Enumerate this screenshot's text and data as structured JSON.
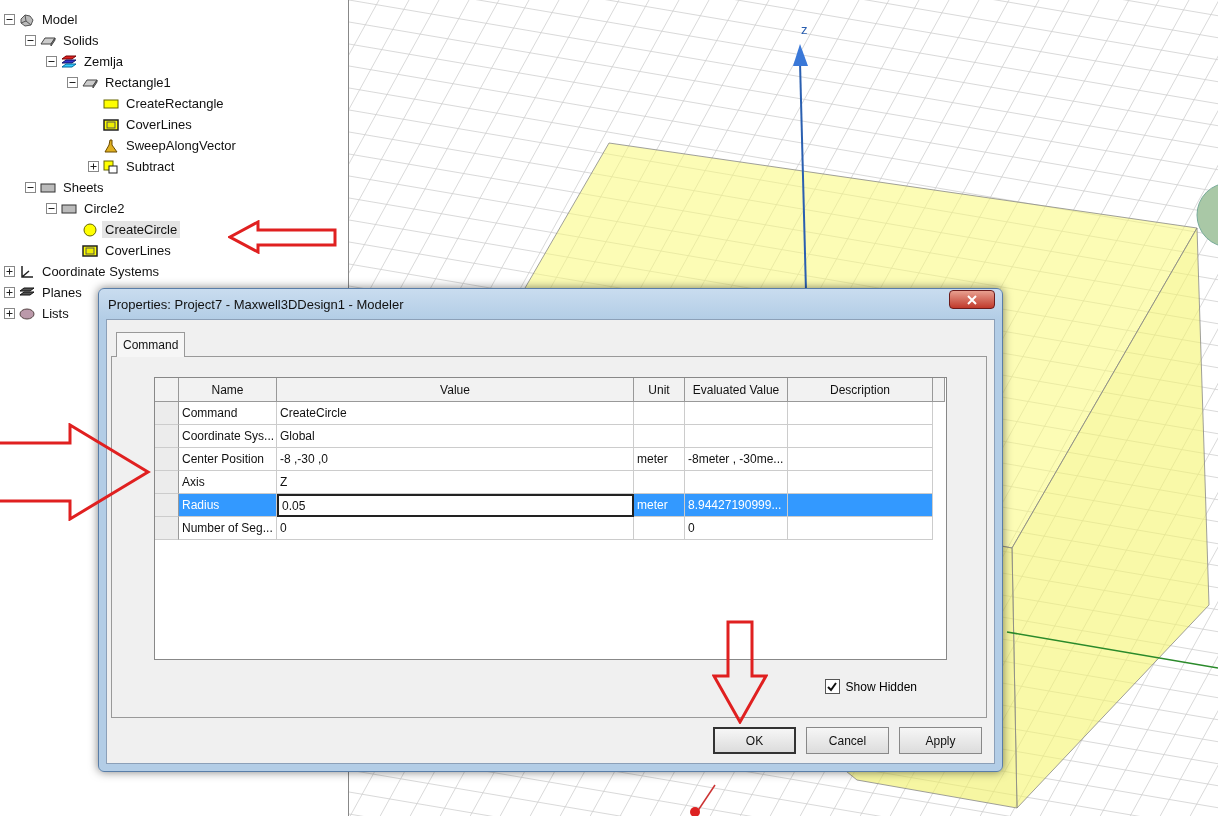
{
  "tree": {
    "items": [
      {
        "label": "Model",
        "kind": "parts",
        "expanded": true,
        "selected": false,
        "children": [
          {
            "label": "Solids",
            "kind": "box",
            "expanded": true,
            "selected": false,
            "children": [
              {
                "label": "Zemlja",
                "kind": "layers",
                "expanded": true,
                "selected": false,
                "children": [
                  {
                    "label": "Rectangle1",
                    "kind": "box",
                    "expanded": true,
                    "selected": false,
                    "children": [
                      {
                        "label": "CreateRectangle",
                        "kind": "rect",
                        "selected": false
                      },
                      {
                        "label": "CoverLines",
                        "kind": "cover",
                        "selected": false
                      },
                      {
                        "label": "SweepAlongVector",
                        "kind": "sweep",
                        "selected": false
                      },
                      {
                        "label": "Subtract",
                        "kind": "subtract",
                        "expanded": false,
                        "selected": false
                      }
                    ]
                  }
                ]
              }
            ]
          },
          {
            "label": "Sheets",
            "kind": "sheet",
            "expanded": true,
            "selected": false,
            "children": [
              {
                "label": "Circle2",
                "kind": "sheet",
                "expanded": true,
                "selected": false,
                "children": [
                  {
                    "label": "CreateCircle",
                    "kind": "circle",
                    "selected": true
                  },
                  {
                    "label": "CoverLines",
                    "kind": "cover",
                    "selected": false
                  }
                ]
              }
            ]
          }
        ]
      },
      {
        "label": "Coordinate Systems",
        "kind": "axes",
        "expanded": false,
        "selected": false
      },
      {
        "label": "Planes",
        "kind": "planes",
        "expanded": false,
        "selected": false
      },
      {
        "label": "Lists",
        "kind": "list",
        "expanded": false,
        "selected": false
      }
    ]
  },
  "viewport": {
    "axis_label": "z"
  },
  "dialog": {
    "title": "Properties: Project7 - Maxwell3DDesign1 - Modeler",
    "tabs": [
      {
        "label": "Command",
        "selected": true
      }
    ],
    "table": {
      "columns": [
        "Name",
        "Value",
        "Unit",
        "Evaluated Value",
        "Description"
      ],
      "rows": [
        {
          "name": "Command",
          "value": "CreateCircle",
          "selected": false,
          "editing": false
        },
        {
          "name": "Coordinate Sys...",
          "value": "Global",
          "selected": false,
          "editing": false
        },
        {
          "name": "Center Position",
          "value": "-8 ,-30 ,0",
          "unit": "meter",
          "evaluated": "-8meter , -30me...",
          "selected": false,
          "editing": false
        },
        {
          "name": "Axis",
          "value": "Z",
          "selected": false,
          "editing": false
        },
        {
          "name": "Radius",
          "value": "0.05",
          "unit": "meter",
          "evaluated": "8.94427190999...",
          "selected": true,
          "editing": true
        },
        {
          "name": "Number of Seg...",
          "value": "0",
          "evaluated": "0",
          "selected": false,
          "editing": false
        }
      ]
    },
    "show_hidden": {
      "label": "Show Hidden",
      "checked": true
    },
    "buttons": [
      {
        "label": "OK",
        "default": true
      },
      {
        "label": "Cancel",
        "default": false
      },
      {
        "label": "Apply",
        "default": false
      }
    ]
  }
}
